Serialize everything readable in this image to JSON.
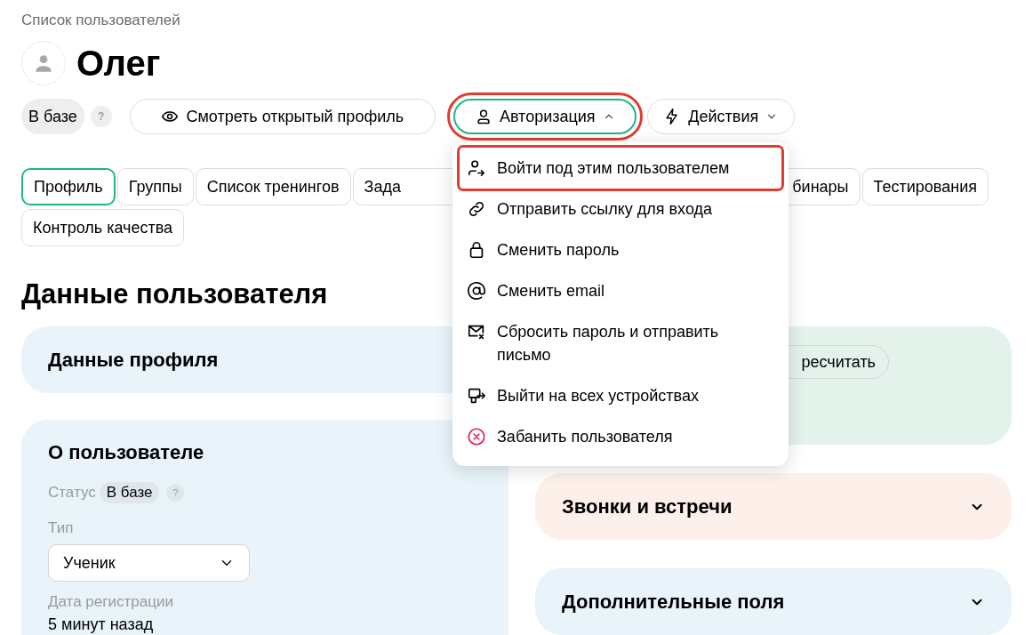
{
  "breadcrumb": "Список пользователей",
  "user": {
    "name": "Олег"
  },
  "status": {
    "label": "В базе",
    "help": "?"
  },
  "actions": [
    {
      "kind": "view",
      "label": "Смотреть открытый профиль",
      "expanded": false,
      "highlighted": false
    },
    {
      "kind": "auth",
      "label": "Авторизация",
      "expanded": true,
      "highlighted": true
    },
    {
      "kind": "bolt",
      "label": "Действия",
      "expanded": false,
      "highlighted": false
    }
  ],
  "auth_menu": [
    {
      "kind": "login",
      "label": "Войти под этим пользователем",
      "highlighted": true
    },
    {
      "kind": "link",
      "label": "Отправить ссылку для входа",
      "highlighted": false
    },
    {
      "kind": "lock",
      "label": "Сменить пароль",
      "highlighted": false
    },
    {
      "kind": "at",
      "label": "Сменить email",
      "highlighted": false
    },
    {
      "kind": "mail",
      "label": "Сбросить пароль и отправить письмо",
      "highlighted": false
    },
    {
      "kind": "logout",
      "label": "Выйти на всех устройствах",
      "highlighted": false
    },
    {
      "kind": "ban",
      "label": "Забанить пользователя",
      "highlighted": false
    }
  ],
  "tabs": [
    {
      "label": "Профиль",
      "selected": true
    },
    {
      "label": "Группы",
      "selected": false
    },
    {
      "label": "Список тренингов",
      "selected": false
    },
    {
      "label": "Зада",
      "selected": false
    },
    {
      "label": "бинары",
      "selected": false
    },
    {
      "label": "Тестирования",
      "selected": false
    },
    {
      "label": "Контроль качества",
      "selected": false
    }
  ],
  "section_title": "Данные пользователя",
  "profile_card": {
    "title": "Данные профиля"
  },
  "recalc_button": "ресчитать",
  "about": {
    "title": "О пользователе",
    "status_label": "Статус",
    "status_value": "В базе",
    "status_help": "?",
    "type_label": "Тип",
    "type_value": "Ученик",
    "reg_label": "Дата регистрации",
    "reg_value": "5 минут назад"
  },
  "panels": [
    {
      "title": "Звонки и встречи",
      "color": "#fdf0eb",
      "expanded": false
    },
    {
      "title": "Дополнительные поля",
      "color": "#e8f3fa",
      "expanded": false
    }
  ]
}
